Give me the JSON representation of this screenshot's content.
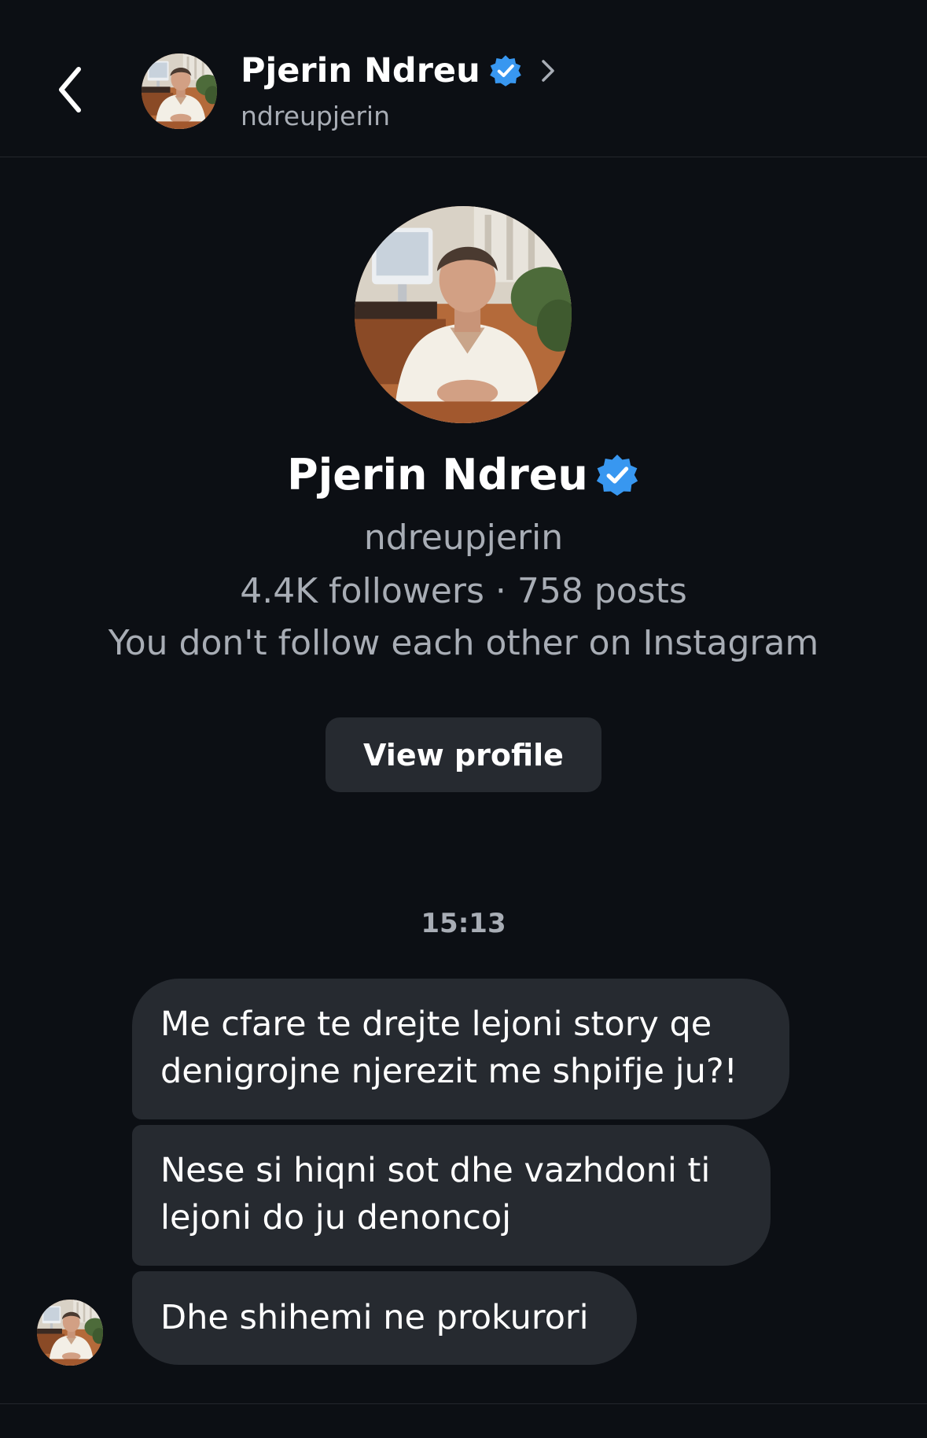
{
  "header": {
    "name": "Pjerin Ndreu",
    "handle": "ndreupjerin"
  },
  "profile": {
    "name": "Pjerin Ndreu",
    "handle": "ndreupjerin",
    "stats": "4.4K followers · 758 posts",
    "mutual": "You don't follow each other on Instagram",
    "view_profile_label": "View profile"
  },
  "conversation": {
    "timestamp": "15:13",
    "messages": [
      {
        "lines": [
          "Me cfare te drejte lejoni story qe",
          "denigrojne njerezit me shpifje ju?!"
        ]
      },
      {
        "lines": [
          "Nese si hiqni sot dhe vazhdoni ti",
          "lejoni do ju denoncoj"
        ]
      },
      {
        "lines": [
          "Dhe shihemi ne prokurori"
        ]
      }
    ]
  },
  "colors": {
    "background": "#0c0f14",
    "bubble": "#262a30",
    "secondary_text": "#a8adb5",
    "verified_badge": "#3897f0"
  },
  "icons": {
    "back": "chevron-left-icon",
    "header_chevron": "chevron-right-icon",
    "verified": "verified-badge-icon"
  }
}
